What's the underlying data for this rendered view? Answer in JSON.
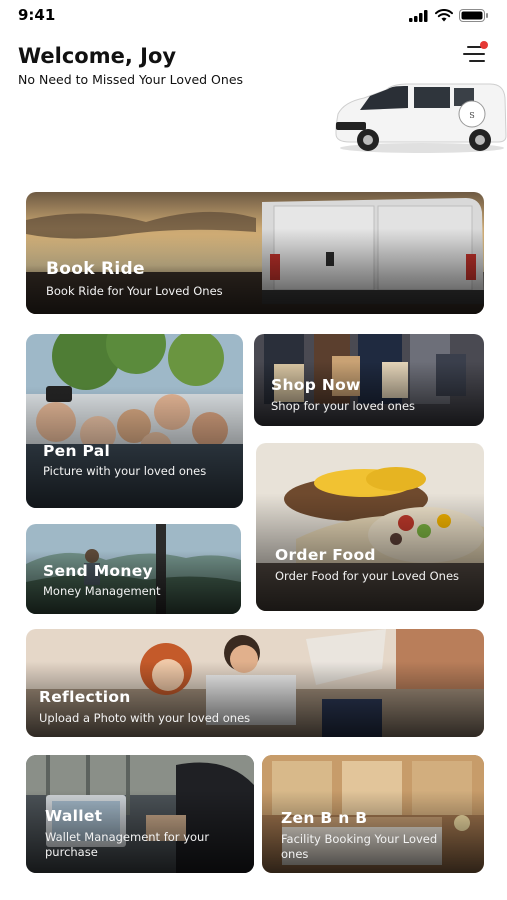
{
  "status": {
    "time": "9:41"
  },
  "header": {
    "greeting": "Welcome, Joy",
    "tagline": "No Need to Missed Your Loved Ones"
  },
  "icons": {
    "signal": "signal-icon",
    "wifi": "wifi-icon",
    "battery": "battery-icon",
    "menu": "menu-icon"
  },
  "colors": {
    "notification_dot": "#e53935",
    "text": "#111111",
    "card_text": "#ffffff"
  },
  "cards": {
    "book_ride": {
      "title": "Book Ride",
      "subtitle": "Book Ride for Your Loved Ones"
    },
    "pen_pal": {
      "title": "Pen Pal",
      "subtitle": "Picture with your loved ones"
    },
    "shop_now": {
      "title": "Shop Now",
      "subtitle": "Shop for your loved ones"
    },
    "send_money": {
      "title": "Send Money",
      "subtitle": "Money Management"
    },
    "order_food": {
      "title": "Order Food",
      "subtitle": "Order Food for your Loved Ones"
    },
    "reflection": {
      "title": "Reflection",
      "subtitle": "Upload a Photo with your loved ones"
    },
    "wallet": {
      "title": "Wallet",
      "subtitle": "Wallet Management for your purchase"
    },
    "zen": {
      "title": "Zen B n B",
      "subtitle": "Facility Booking Your Loved ones"
    }
  }
}
